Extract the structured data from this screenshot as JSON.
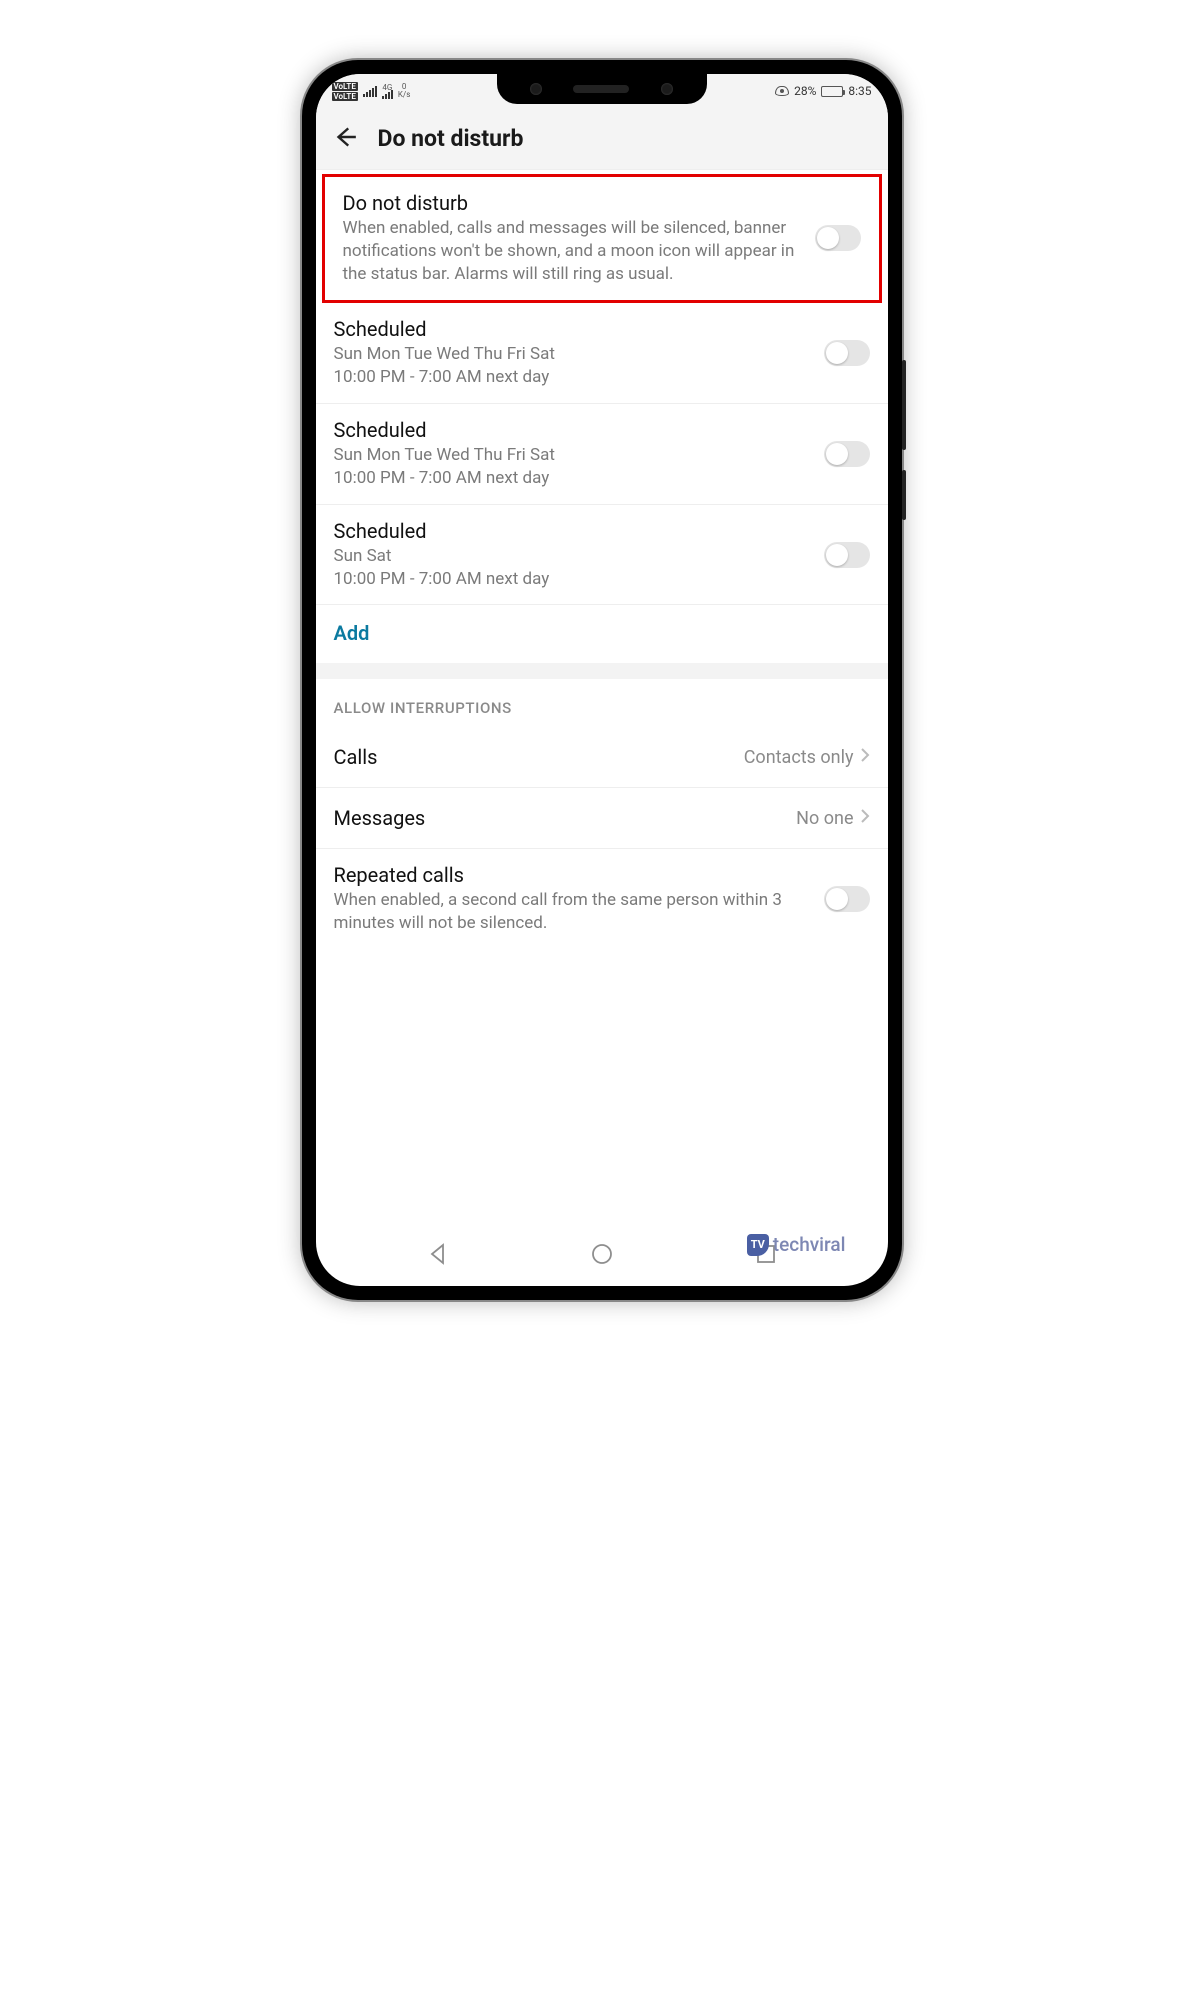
{
  "status": {
    "volte": "VoLTE",
    "net_label_top": "4G",
    "speed_top": "0",
    "speed_unit": "K/s",
    "battery_pct": "28%",
    "time": "8:35"
  },
  "header": {
    "title": "Do not disturb"
  },
  "dnd": {
    "title": "Do not disturb",
    "desc": "When enabled, calls and messages will be silenced, banner notifications won't be shown, and a moon icon will appear in the status bar. Alarms will still ring as usual."
  },
  "schedules": [
    {
      "title": "Scheduled",
      "days": "Sun Mon Tue Wed Thu Fri Sat",
      "time": "10:00 PM - 7:00 AM next day"
    },
    {
      "title": "Scheduled",
      "days": "Sun Mon Tue Wed Thu Fri Sat",
      "time": "10:00 PM - 7:00 AM next day"
    },
    {
      "title": "Scheduled",
      "days": "Sun Sat",
      "time": "10:00 PM - 7:00 AM next day"
    }
  ],
  "add_label": "Add",
  "interruptions": {
    "header": "ALLOW INTERRUPTIONS",
    "calls_label": "Calls",
    "calls_value": "Contacts only",
    "messages_label": "Messages",
    "messages_value": "No one",
    "repeated_title": "Repeated calls",
    "repeated_desc": "When enabled, a second call from the same person within 3 minutes will not be silenced."
  },
  "watermark": {
    "logo": "TV",
    "text": "techviral"
  }
}
